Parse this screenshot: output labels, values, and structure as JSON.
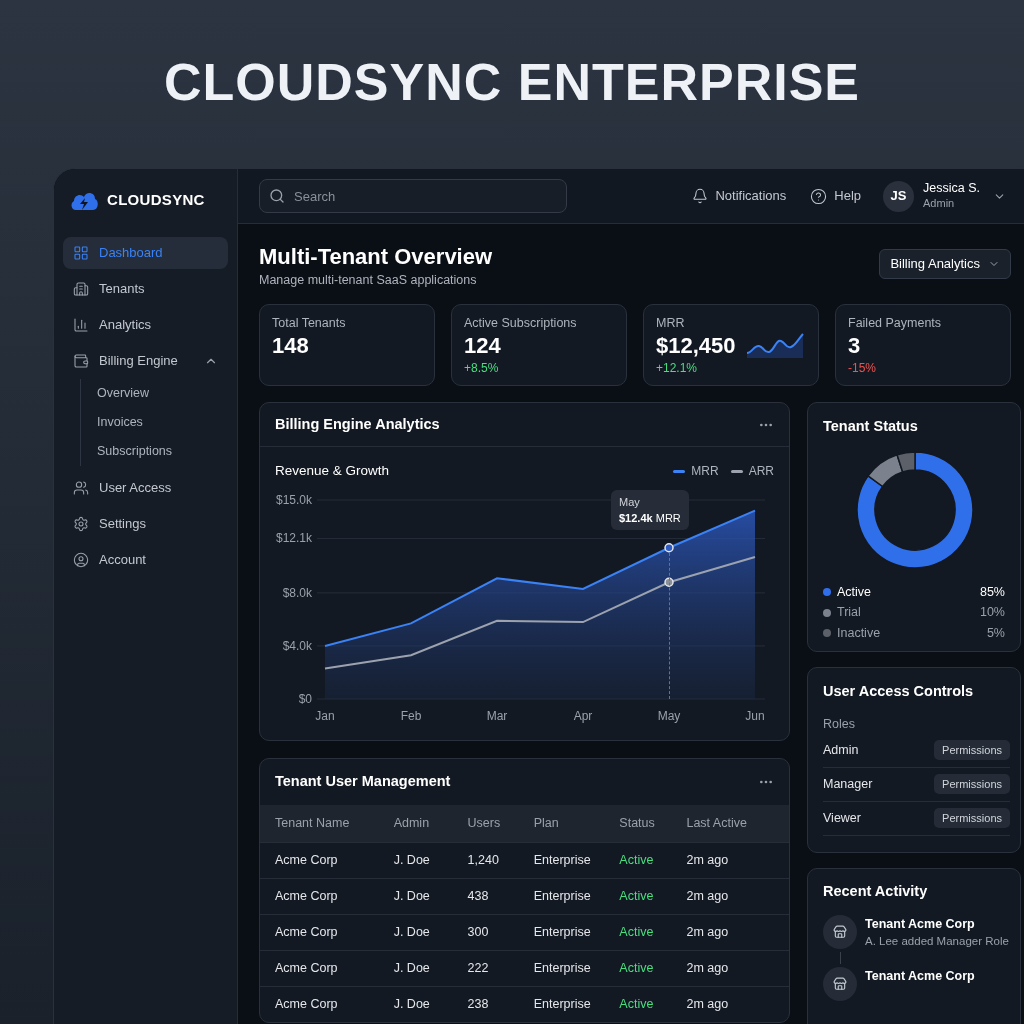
{
  "hero_title": "CLOUDSYNC ENTERPRISE",
  "sidebar": {
    "logo": "CLOUDSYNC",
    "items": [
      {
        "label": "Dashboard",
        "selected": true
      },
      {
        "label": "Tenants",
        "selected": false
      },
      {
        "label": "Analytics",
        "selected": false
      },
      {
        "label": "Billing Engine",
        "selected": false,
        "expanded": true,
        "children": [
          {
            "label": "Overview",
            "selected": false
          },
          {
            "label": "Invoices",
            "selected": false
          },
          {
            "label": "Subscriptions",
            "selected": false
          }
        ]
      },
      {
        "label": "User Access",
        "selected": false
      },
      {
        "label": "Settings",
        "selected": false
      },
      {
        "label": "Account",
        "selected": false
      }
    ]
  },
  "header": {
    "search": {
      "placeholder": "Search"
    },
    "notifications": "Notifications",
    "help": "Help",
    "user": {
      "initials": "JS",
      "name": "Jessica S.",
      "role": "Admin"
    }
  },
  "page": {
    "title": "Multi-Tenant Overview",
    "subtitle": "Manage multi-tenant SaaS applications",
    "view_selector": "Billing Analytics"
  },
  "stats": [
    {
      "label": "Total Tenants",
      "value": "148",
      "kind": "plain"
    },
    {
      "label": "Active Subscriptions",
      "value": "124",
      "change": "+8.5%",
      "color": "#4ade80",
      "kind": "plain"
    },
    {
      "label": "MRR",
      "value": "$12,450",
      "change": "+12.1%",
      "color": "#4ade80",
      "kind": "sparkline"
    },
    {
      "label": "Failed Payments",
      "value": "3",
      "change": "-15%",
      "color": "#ef5350",
      "kind": "plain"
    }
  ],
  "billing_card": {
    "title": "Billing Engine Analytics",
    "tooltip": {
      "title": "May",
      "text": "**$12.4k** MRR"
    },
    "chart_data": {
      "type": "area",
      "title": "Revenue & Growth",
      "categories": [
        "Jan",
        "Feb",
        "Mar",
        "Apr",
        "May",
        "Jun"
      ],
      "series": [
        {
          "name": "MRR",
          "type": "area",
          "color": "#3b82f6",
          "values": [
            4.0,
            5.7,
            9.1,
            8.3,
            11.4,
            14.2
          ]
        },
        {
          "name": "ARR",
          "type": "line",
          "color": "#9ca3af",
          "values": [
            2.3,
            3.3,
            5.9,
            5.8,
            8.8,
            10.7
          ]
        }
      ],
      "grid": true,
      "ylim": [
        0,
        15
      ],
      "yticks": [
        {
          "value": 0,
          "label": "$0"
        },
        {
          "value": 4,
          "label": "$4.0k"
        },
        {
          "value": 8,
          "label": "$8.0k"
        },
        {
          "value": 12.1,
          "label": "$12.1k"
        },
        {
          "value": 15,
          "label": "$15.0k"
        }
      ]
    }
  },
  "tenant_status": {
    "title": "Tenant Status",
    "chart_data": {
      "type": "donut",
      "categories": [
        "Active",
        "Trial",
        "Inactive"
      ],
      "values": [
        85,
        10,
        5
      ],
      "colors": [
        "#2f6fea",
        "#7c828d",
        "#5b6069"
      ]
    },
    "percent_labels": [
      "85%",
      "10%",
      "5%"
    ]
  },
  "table": {
    "title": "Tenant User Management",
    "columns": [
      "Tenant Name",
      "Admin",
      "Users",
      "Plan",
      "Status",
      "Last Active"
    ],
    "rows": [
      [
        "Acme Corp",
        "J. Doe",
        "1,240",
        "Enterprise",
        "Active",
        "2m ago"
      ],
      [
        "Acme Corp",
        "J. Doe",
        "438",
        "Enterprise",
        "Active",
        "2m ago"
      ],
      [
        "Acme Corp",
        "J. Doe",
        "300",
        "Enterprise",
        "Active",
        "2m ago"
      ],
      [
        "Acme Corp",
        "J. Doe",
        "222",
        "Enterprise",
        "Active",
        "2m ago"
      ],
      [
        "Acme Corp",
        "J. Doe",
        "238",
        "Enterprise",
        "Active",
        "2m ago"
      ]
    ]
  },
  "access": {
    "title": "User Access Controls",
    "roles_label": "Roles",
    "roles": [
      {
        "name": "Admin",
        "action": "Permissions"
      },
      {
        "name": "Manager",
        "action": "Permissions"
      },
      {
        "name": "Viewer",
        "action": "Permissions"
      }
    ]
  },
  "activity": {
    "title": "Recent Activity",
    "items": [
      {
        "title": "Tenant Acme Corp",
        "detail": "A. Lee added Manager Role"
      },
      {
        "title": "Tenant Acme Corp"
      }
    ]
  }
}
